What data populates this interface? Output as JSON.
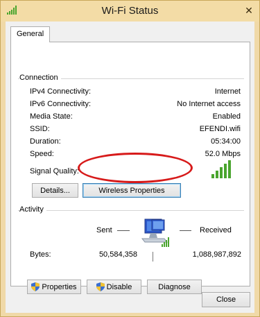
{
  "window": {
    "title": "Wi-Fi Status",
    "close_glyph": "✕",
    "icon": "signal-bars-icon"
  },
  "tabs": [
    {
      "label": "General"
    }
  ],
  "connection": {
    "heading": "Connection",
    "rows": [
      {
        "label": "IPv4 Connectivity:",
        "value": "Internet"
      },
      {
        "label": "IPv6 Connectivity:",
        "value": "No Internet access"
      },
      {
        "label": "Media State:",
        "value": "Enabled"
      },
      {
        "label": "SSID:",
        "value": "EFENDI.wifi"
      },
      {
        "label": "Duration:",
        "value": "05:34:00"
      },
      {
        "label": "Speed:",
        "value": "52.0 Mbps"
      }
    ],
    "signal_label": "Signal Quality:",
    "signal_bars_lit": 5,
    "signal_bars_total": 5,
    "details_button": "Details...",
    "wireless_button": "Wireless Properties"
  },
  "activity": {
    "heading": "Activity",
    "sent_label": "Sent",
    "received_label": "Received",
    "bytes_label": "Bytes:",
    "bytes_sent": "50,584,358",
    "bytes_received": "1,088,987,892"
  },
  "actions": {
    "properties": "Properties",
    "disable": "Disable",
    "diagnose": "Diagnose"
  },
  "footer": {
    "close": "Close"
  },
  "colors": {
    "signal_green": "#4aa52e",
    "annotation_red": "#d71a1a",
    "frame": "#f0d9a8"
  }
}
